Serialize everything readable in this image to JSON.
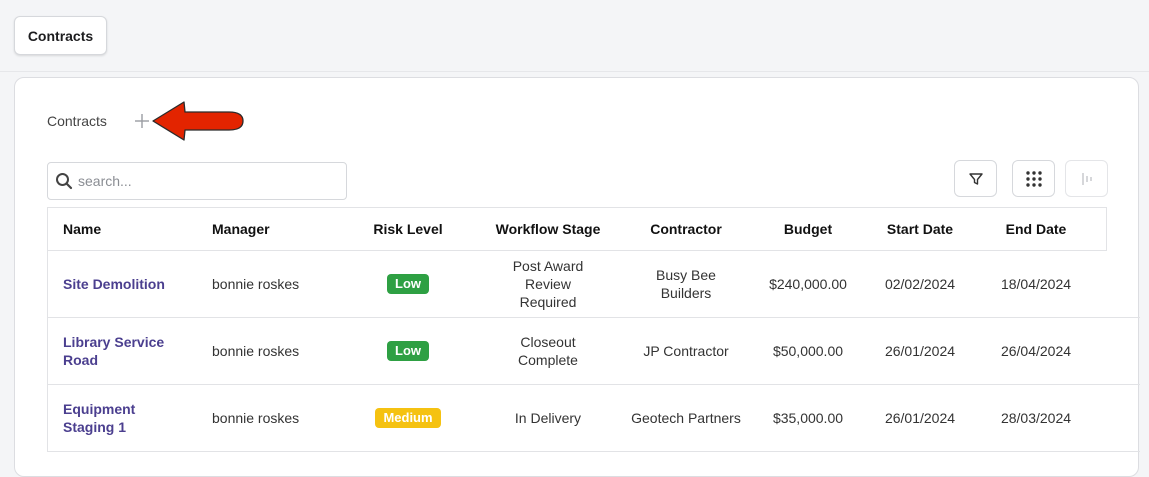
{
  "header": {
    "tab_label": "Contracts"
  },
  "section": {
    "title": "Contracts"
  },
  "search": {
    "placeholder": "search..."
  },
  "colors": {
    "risk_low": "#2ea043",
    "risk_medium": "#f5c211",
    "link": "#4b3f8f",
    "annotation_arrow": "#e32400"
  },
  "icons": {
    "add": "plus-icon",
    "search": "search-icon",
    "filter": "filter-icon",
    "grid": "grid-dots-icon",
    "columns": "column-bars-icon",
    "annotation": "red-arrow-icon"
  },
  "table": {
    "columns": [
      "Name",
      "Manager",
      "Risk Level",
      "Workflow Stage",
      "Contractor",
      "Budget",
      "Start Date",
      "End Date"
    ],
    "rows": [
      {
        "name": "Site Demolition",
        "manager": "bonnie roskes",
        "risk": "Low",
        "stage": "Post Award Review Required",
        "contractor": "Busy Bee Builders",
        "budget": "$240,000.00",
        "start": "02/02/2024",
        "end": "18/04/2024"
      },
      {
        "name": "Library Service Road",
        "manager": "bonnie roskes",
        "risk": "Low",
        "stage": "Closeout Complete",
        "contractor": "JP Contractor",
        "budget": "$50,000.00",
        "start": "26/01/2024",
        "end": "26/04/2024"
      },
      {
        "name": "Equipment Staging 1",
        "manager": "bonnie roskes",
        "risk": "Medium",
        "stage": "In Delivery",
        "contractor": "Geotech Partners",
        "budget": "$35,000.00",
        "start": "26/01/2024",
        "end": "28/03/2024"
      }
    ]
  }
}
